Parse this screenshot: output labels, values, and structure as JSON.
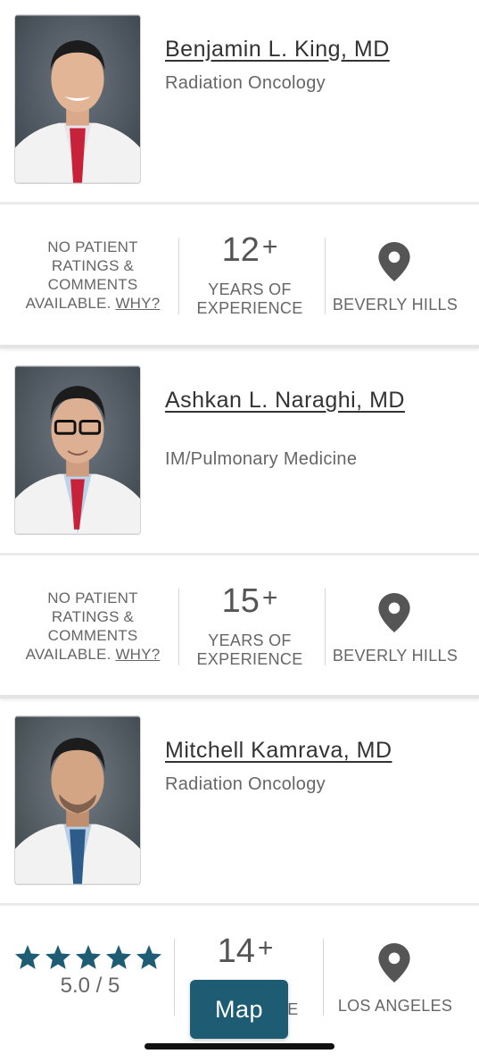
{
  "colors": {
    "accent": "#1d5c73",
    "star": "#1d5c73"
  },
  "doctors": [
    {
      "name": "Benjamin L. King, MD",
      "specialty": "Radiation Oncology",
      "ratings": {
        "line1": "NO PATIENT",
        "line2": "RATINGS &",
        "line3": "COMMENTS",
        "line4a": "AVAILABLE.",
        "why": "WHY?"
      },
      "years": "12",
      "years_plus": "+",
      "years_label1": "YEARS OF",
      "years_label2": "EXPERIENCE",
      "location": "BEVERLY HILLS",
      "icon": "location-pin-icon"
    },
    {
      "name": "Ashkan L. Naraghi, MD",
      "specialty": "IM/Pulmonary Medicine",
      "ratings": {
        "line1": "NO PATIENT",
        "line2": "RATINGS &",
        "line3": "COMMENTS",
        "line4a": "AVAILABLE.",
        "why": "WHY?"
      },
      "years": "15",
      "years_plus": "+",
      "years_label1": "YEARS OF",
      "years_label2": "EXPERIENCE",
      "location": "BEVERLY HILLS",
      "icon": "location-pin-icon"
    },
    {
      "name": "Mitchell Kamrava, MD",
      "specialty": "Radiation Oncology",
      "rating": {
        "stars": 5,
        "text": "5.0 / 5"
      },
      "years": "14",
      "years_plus": "+",
      "years_label1": "YEARS OF",
      "years_label2": "EXPERIENCE",
      "location": "LOS ANGELES",
      "icon": "location-pin-icon"
    }
  ],
  "map_button": {
    "label": "Map"
  }
}
